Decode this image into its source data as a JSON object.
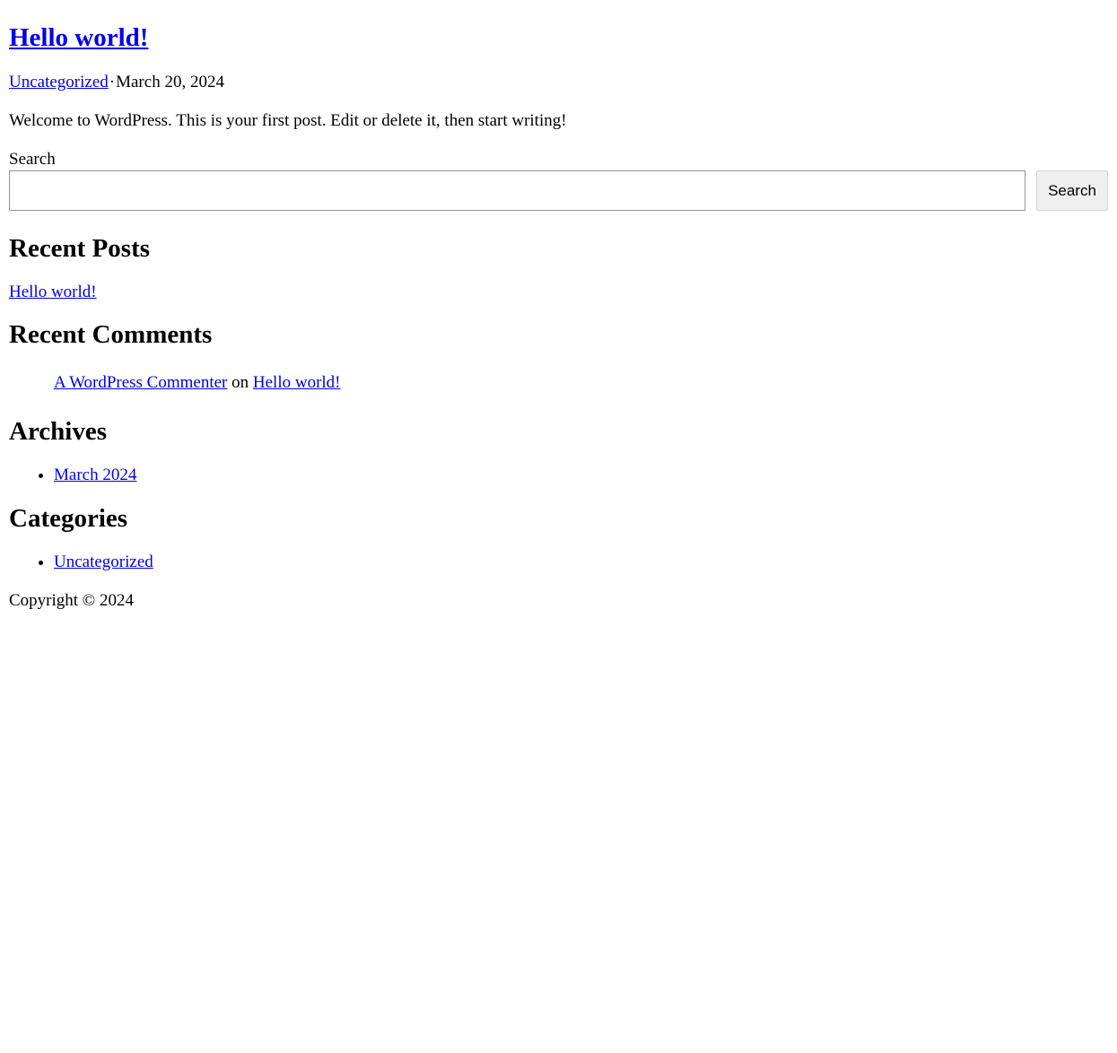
{
  "post": {
    "title": "Hello world!",
    "category": "Uncategorized",
    "separator": "·",
    "date": "March 20, 2024",
    "excerpt": "Welcome to WordPress. This is your first post. Edit or delete it, then start writing!"
  },
  "search": {
    "label": "Search",
    "value": "",
    "placeholder": "",
    "button_label": "Search"
  },
  "recent_posts": {
    "heading": "Recent Posts",
    "items": [
      {
        "label": "Hello world!"
      }
    ]
  },
  "recent_comments": {
    "heading": "Recent Comments",
    "items": [
      {
        "author": "A WordPress Commenter",
        "connector": "on",
        "post": "Hello world!"
      }
    ]
  },
  "archives": {
    "heading": "Archives",
    "items": [
      {
        "label": "March 2024"
      }
    ]
  },
  "categories": {
    "heading": "Categories",
    "items": [
      {
        "label": "Uncategorized"
      }
    ]
  },
  "footer": {
    "copyright": "Copyright © 2024"
  },
  "colors": {
    "link": "#0000ee",
    "text": "#000000",
    "button_bg": "#efefef"
  }
}
